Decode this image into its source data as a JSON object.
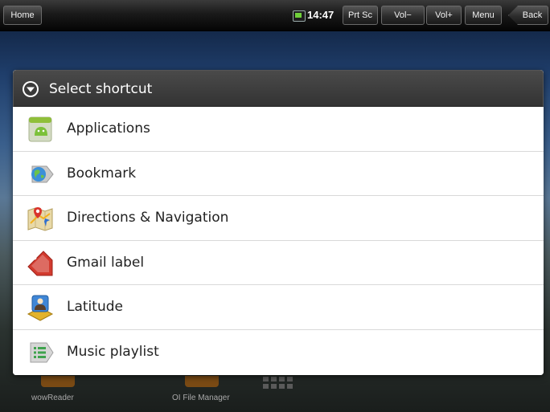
{
  "statusbar": {
    "home_label": "Home",
    "time": "14:47",
    "prtsc_label": "Prt Sc",
    "vol_down_label": "Vol−",
    "vol_up_label": "Vol+",
    "menu_label": "Menu",
    "back_label": "Back"
  },
  "dialog": {
    "title": "Select shortcut",
    "items": [
      {
        "label": "Applications",
        "icon": "android-app-icon"
      },
      {
        "label": "Bookmark",
        "icon": "bookmark-globe-icon"
      },
      {
        "label": "Directions & Navigation",
        "icon": "map-navigation-icon"
      },
      {
        "label": "Gmail label",
        "icon": "gmail-label-icon"
      },
      {
        "label": "Latitude",
        "icon": "latitude-icon"
      },
      {
        "label": "Music playlist",
        "icon": "music-playlist-icon"
      }
    ]
  },
  "dock": {
    "left_label": "wowReader",
    "middle_label": "OI File Manager"
  },
  "colors": {
    "header_bg": "#333333",
    "list_bg": "#ffffff",
    "divider": "#d9d9d9"
  }
}
